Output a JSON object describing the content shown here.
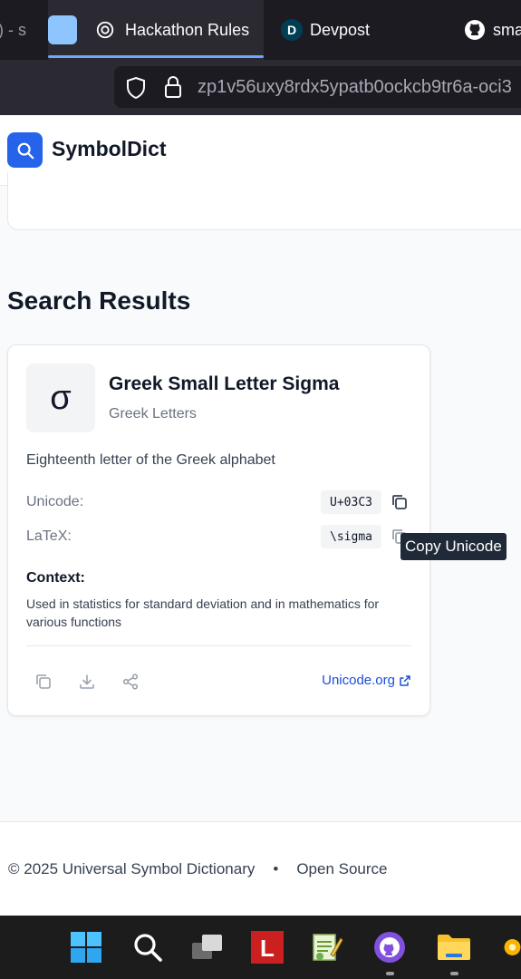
{
  "browser": {
    "tabs": [
      {
        "label": ") - s"
      },
      {
        "label": "Hackathon Rules"
      },
      {
        "label": "Devpost"
      },
      {
        "label": "sma"
      }
    ],
    "url": "zp1v56uxy8rdx5ypatb0ockcb9tr6a-oci3"
  },
  "app": {
    "brand": "SymbolDict"
  },
  "results": {
    "title": "Search Results",
    "card": {
      "glyph": "σ",
      "name": "Greek Small Letter Sigma",
      "category": "Greek Letters",
      "description": "Eighteenth letter of the Greek alphabet",
      "unicode_label": "Unicode:",
      "unicode_value": "U+03C3",
      "latex_label": "LaTeX:",
      "latex_value": "\\sigma",
      "context_label": "Context:",
      "context_text": "Used in statistics for standard deviation and in mathematics for various functions",
      "external_link": "Unicode.org"
    }
  },
  "tooltip": "Copy Unicode",
  "footer": {
    "copyright": "© 2025 Universal Symbol Dictionary",
    "separator": "•",
    "link": "Open Source"
  },
  "colors": {
    "accent": "#2563eb",
    "link": "#1d4ed8"
  }
}
